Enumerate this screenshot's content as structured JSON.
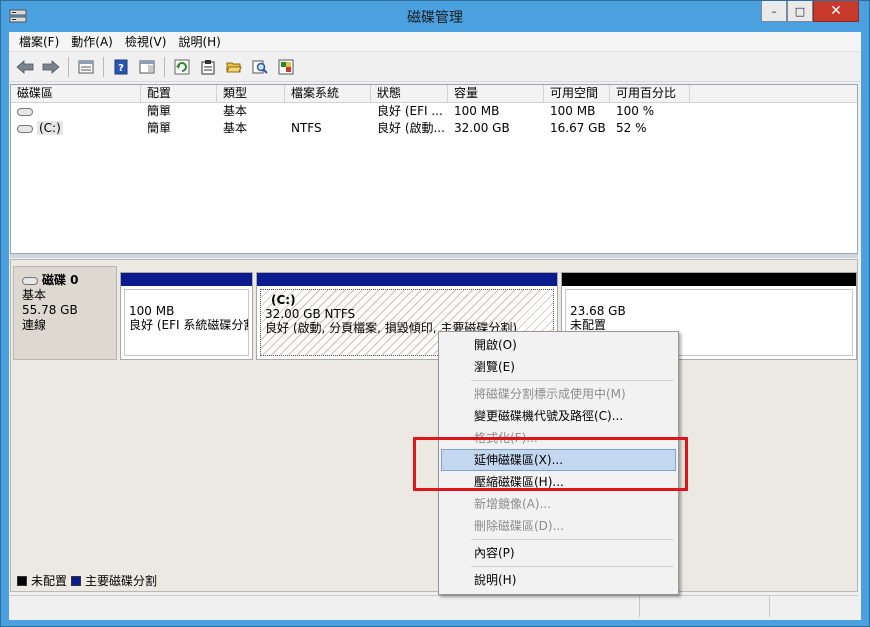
{
  "window": {
    "title": "磁碟管理",
    "minimize": "–",
    "maximize": "□",
    "close": "✕"
  },
  "menubar": [
    "檔案(F)",
    "動作(A)",
    "檢視(V)",
    "說明(H)"
  ],
  "toolbar": {
    "buttons": [
      "back-icon",
      "forward-icon",
      "list-view-icon",
      "help-icon",
      "properties-pane-icon",
      "refresh-icon",
      "properties-icon",
      "open-folder-icon",
      "search-icon",
      "rescan-icon"
    ]
  },
  "volumes": {
    "columns": [
      "磁碟區",
      "配置",
      "類型",
      "檔案系統",
      "狀態",
      "容量",
      "可用空間",
      "可用百分比"
    ],
    "rows": [
      [
        "",
        "簡單",
        "基本",
        "",
        "良好 (EFI ...",
        "100 MB",
        "100 MB",
        "100 %"
      ],
      [
        "(C:)",
        "簡單",
        "基本",
        "NTFS",
        "良好 (啟動...",
        "32.00 GB",
        "16.67 GB",
        "52 %"
      ]
    ]
  },
  "disk": {
    "name": "磁碟 0",
    "type": "基本",
    "size": "55.78 GB",
    "status": "連線",
    "partitions": [
      {
        "name": "",
        "size": "100 MB",
        "status": "良好 (EFI 系統磁碟分割)",
        "bar_color": "#0b1a8c"
      },
      {
        "name": "(C:)",
        "size": "32.00 GB NTFS",
        "status": "良好 (啟動, 分頁檔案, 損毀傾印, 主要磁碟分割)",
        "bar_color": "#0b1a8c"
      },
      {
        "name": "",
        "size": "23.68 GB",
        "status": "未配置",
        "bar_color": "#000000"
      }
    ]
  },
  "legend": [
    {
      "label": "未配置",
      "color": "#000000"
    },
    {
      "label": "主要磁碟分割",
      "color": "#0b1a8c"
    }
  ],
  "context_menu": {
    "items": [
      {
        "label": "開啟(O)",
        "enabled": true
      },
      {
        "label": "瀏覽(E)",
        "enabled": true
      },
      {
        "label": "將磁碟分割標示成使用中(M)",
        "enabled": false
      },
      {
        "label": "變更磁碟機代號及路徑(C)...",
        "enabled": true
      },
      {
        "label": "格式化(F)...",
        "enabled": false
      },
      {
        "label": "延伸磁碟區(X)...",
        "enabled": true,
        "highlighted": true
      },
      {
        "label": "壓縮磁碟區(H)...",
        "enabled": true
      },
      {
        "label": "新增鏡像(A)...",
        "enabled": false
      },
      {
        "label": "刪除磁碟區(D)...",
        "enabled": false
      },
      {
        "label": "內容(P)",
        "enabled": true
      },
      {
        "label": "說明(H)",
        "enabled": true
      }
    ],
    "highlight_color": "#e0141b"
  }
}
